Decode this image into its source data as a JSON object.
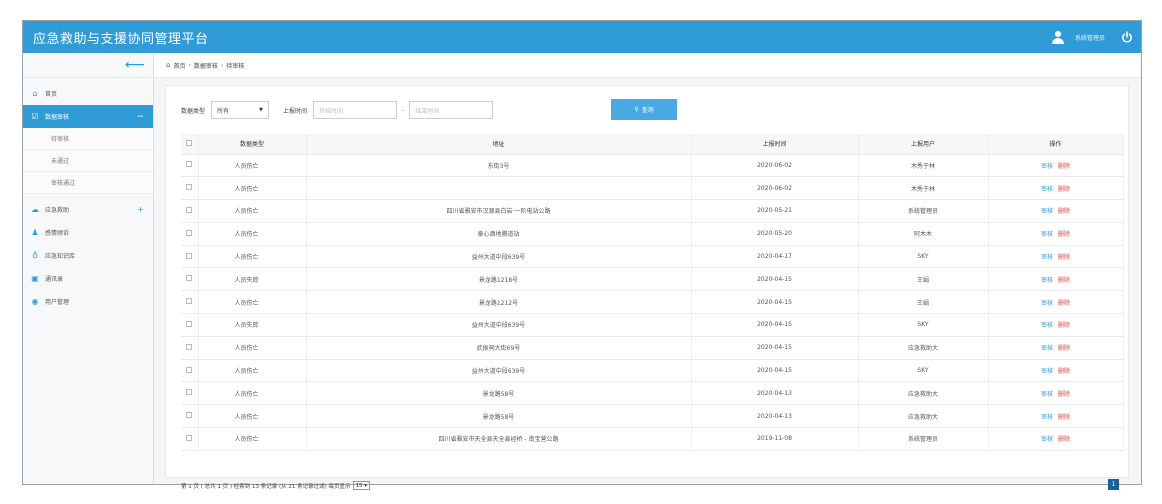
{
  "app": {
    "title": "应急救助与支援协同管理平台",
    "user": "系统管理员"
  },
  "colors": {
    "accent": "#2f9cd8",
    "delete": "#e0453a",
    "audit": "#3a97d6"
  },
  "sidebar": {
    "items": [
      {
        "label": "首页",
        "icon": "home-icon"
      },
      {
        "label": "数据审核",
        "icon": "check-square-icon",
        "active": true,
        "extra": "−"
      },
      {
        "label": "应急救助",
        "icon": "cloud-icon",
        "extra": "+"
      },
      {
        "label": "感情倾诉",
        "icon": "person-icon"
      },
      {
        "label": "应急知识库",
        "icon": "bulb-icon"
      },
      {
        "label": "通讯录",
        "icon": "book-icon"
      },
      {
        "label": "用户管理",
        "icon": "user-circle-icon"
      }
    ],
    "subitems": [
      {
        "label": "待审核"
      },
      {
        "label": "未通过"
      },
      {
        "label": "审核通过"
      }
    ]
  },
  "breadcrumb": {
    "home": "首页",
    "level1": "数据审核",
    "level2": "待审核",
    "sep": "›"
  },
  "filters": {
    "type_label": "数据类型",
    "type_value": "所有",
    "time_label": "上报时间",
    "start_placeholder": "开始时间",
    "end_placeholder": "结束时间",
    "dash": "-",
    "query_label": "查询"
  },
  "table": {
    "headers": [
      "数据类型",
      "地址",
      "上报时间",
      "上报用户",
      "操作"
    ],
    "audit_label": "审核",
    "delete_label": "删除",
    "rows": [
      {
        "type": "人员伤亡",
        "address": "东街3号",
        "time": "2020-06-02",
        "user": "木秀于林"
      },
      {
        "type": "人员伤亡",
        "address": "",
        "time": "2020-06-02",
        "user": "木秀于林"
      },
      {
        "type": "人员伤亡",
        "address": "四川省雅安市汉源县白岩·一阶电站公路",
        "time": "2020-05-21",
        "user": "系统管理员"
      },
      {
        "type": "人员伤亡",
        "address": "泰心酒地腾道站",
        "time": "2020-05-20",
        "user": "阿木木"
      },
      {
        "type": "人员伤亡",
        "address": "益州大道中段639号",
        "time": "2020-04-17",
        "user": "SKY"
      },
      {
        "type": "人员失踪",
        "address": "景龙路1218号",
        "time": "2020-04-15",
        "user": "王娟"
      },
      {
        "type": "人员伤亡",
        "address": "景龙路1212号",
        "time": "2020-04-15",
        "user": "王娟"
      },
      {
        "type": "人员失踪",
        "address": "益州大道中段639号",
        "time": "2020-04-15",
        "user": "SKY"
      },
      {
        "type": "人员伤亡",
        "address": "武侯祠大街69号",
        "time": "2020-04-15",
        "user": "应急救助大"
      },
      {
        "type": "人员伤亡",
        "address": "益州大道中段639号",
        "time": "2020-04-15",
        "user": "SKY"
      },
      {
        "type": "人员伤亡",
        "address": "景龙路58号",
        "time": "2020-04-13",
        "user": "应急救助大"
      },
      {
        "type": "人员伤亡",
        "address": "景龙路58号",
        "time": "2020-04-13",
        "user": "应急救助大"
      },
      {
        "type": "人员伤亡",
        "address": "四川省雅安市天全县天全县经桥 - 南宝营公路",
        "time": "2019-11-08",
        "user": "系统管理员"
      }
    ]
  },
  "pager": {
    "summary": "第 1 页 ( 总共 1 页 ) 检索到 13 条记录 (从 21 条记录过滤) 每页显示",
    "page_size": "15 ▾",
    "current_page": "1"
  }
}
